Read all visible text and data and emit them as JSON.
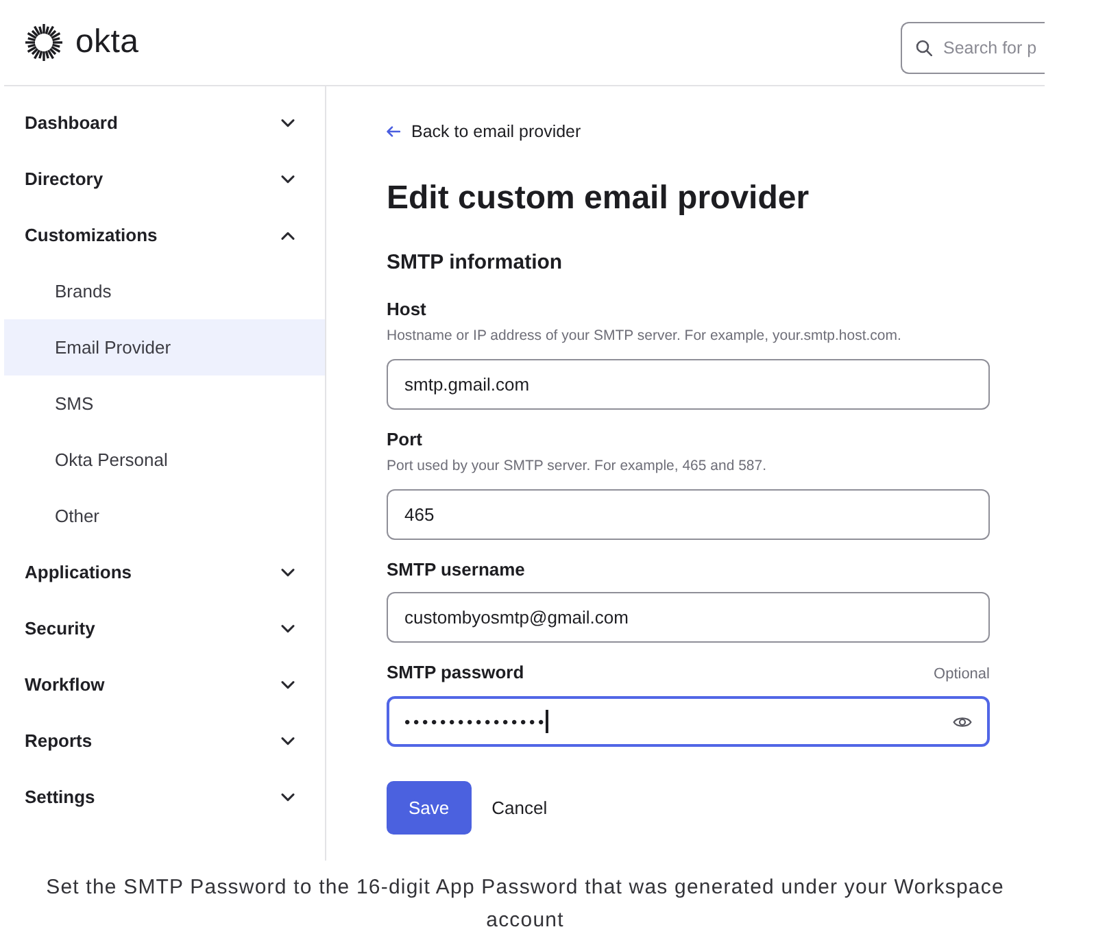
{
  "header": {
    "logo": "okta",
    "search": {
      "placeholder": "Search for p"
    }
  },
  "sidebar": {
    "items": [
      {
        "label": "Dashboard",
        "selected": false,
        "expanded": false
      },
      {
        "label": "Directory",
        "selected": false,
        "expanded": false
      },
      {
        "label": "Customizations",
        "selected": false,
        "expanded": true,
        "children": [
          {
            "label": "Brands",
            "selected": false
          },
          {
            "label": "Email Provider",
            "selected": true
          },
          {
            "label": "SMS",
            "selected": false
          },
          {
            "label": "Okta Personal",
            "selected": false
          },
          {
            "label": "Other",
            "selected": false
          }
        ]
      },
      {
        "label": "Applications",
        "selected": false,
        "expanded": false
      },
      {
        "label": "Security",
        "selected": false,
        "expanded": false
      },
      {
        "label": "Workflow",
        "selected": false,
        "expanded": false
      },
      {
        "label": "Reports",
        "selected": false,
        "expanded": false
      },
      {
        "label": "Settings",
        "selected": false,
        "expanded": false
      }
    ]
  },
  "main": {
    "back_link": "Back to email provider",
    "title": "Edit custom email provider",
    "section_title": "SMTP information",
    "fields": [
      {
        "kind": "text",
        "label": "Host",
        "hint": "Hostname or IP address of your SMTP server. For example, your.smtp.host.com.",
        "value": "smtp.gmail.com",
        "focused": false
      },
      {
        "kind": "text",
        "label": "Port",
        "hint": "Port used by your SMTP server. For example, 465 and 587.",
        "value": "465",
        "focused": false
      },
      {
        "kind": "text",
        "label": "SMTP username",
        "value": "custombyosmtp@gmail.com",
        "focused": false
      },
      {
        "kind": "password",
        "label": "SMTP password",
        "optional_label": "Optional",
        "value": "••••••••••••••••",
        "focused": true
      }
    ],
    "buttons": [
      {
        "kind": "primary",
        "label": "Save"
      },
      {
        "kind": "secondary",
        "label": "Cancel"
      }
    ]
  },
  "caption": "Set the SMTP Password to the 16-digit App Password that was generated under your Workspace account"
}
